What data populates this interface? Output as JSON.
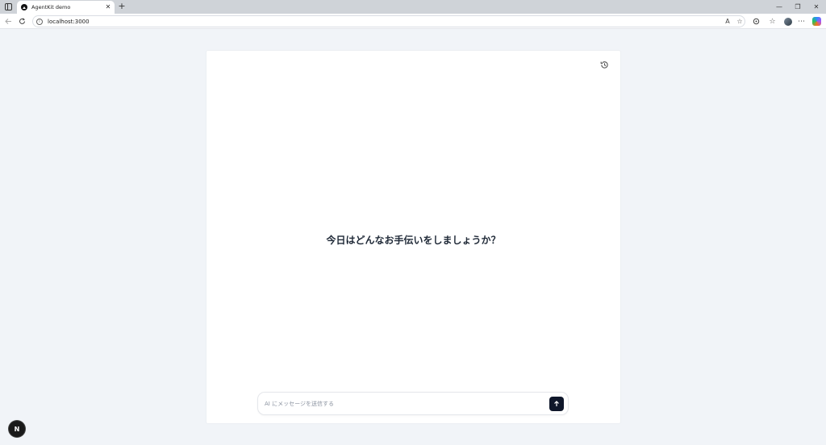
{
  "browser": {
    "tab": {
      "title": "AgentKit demo",
      "close": "✕"
    },
    "new_tab": "+",
    "window": {
      "minimize": "—",
      "restore": "❐",
      "close": "✕"
    },
    "address": {
      "url": "localhost:3000"
    },
    "icons": [
      "sidebar-icon",
      "back-icon",
      "refresh-icon",
      "info-icon",
      "read-aloud-icon",
      "favorite-icon",
      "extensions-icon",
      "favorites-icon",
      "profile-icon",
      "more-icon",
      "copilot-icon"
    ]
  },
  "chat": {
    "welcome": "今日はどんなお手伝いをしましょうか？",
    "input": {
      "placeholder": "AI にメッセージを送信する",
      "value": ""
    }
  },
  "devtools": {
    "badge": "N"
  },
  "colors": {
    "page_bg": "#f1f4f8",
    "card_bg": "#ffffff",
    "send_button": "#0f172a",
    "text": "#1f2937"
  }
}
